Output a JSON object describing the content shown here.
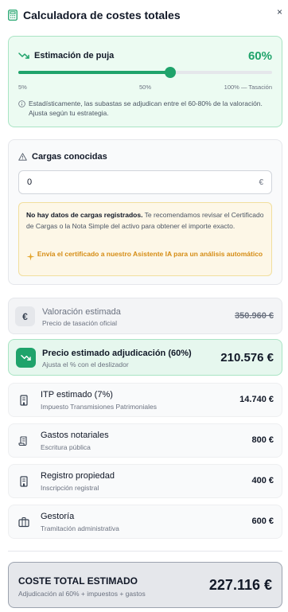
{
  "header": {
    "title": "Calculadora de costes totales",
    "close_icon": "×"
  },
  "bid_estimate": {
    "label": "Estimación de puja",
    "percent_label": "60%",
    "slider_value": 0.6,
    "slider_min_label": "5%",
    "slider_mid_label": "50%",
    "slider_max_label": "100% — Tasación",
    "note": "Estadísticamente, las subastas se adjudican entre el 60-80% de la valoración. Ajusta según tu estrategia.",
    "accent": "#1fa36b"
  },
  "loads": {
    "label": "Cargas conocidas",
    "input_value": "0",
    "currency": "€",
    "alert_bold": "No hay datos de cargas registrados.",
    "alert_text": " Te recomendamos revisar el Certificado de Cargas o la Nota Simple del activo para obtener el importe exacto.",
    "ai_link": "Envía el certificado a nuestro Asistente IA para un análisis automático"
  },
  "valuation": {
    "icon": "€",
    "title": "Valoración estimada",
    "subtitle": "Precio de tasación oficial",
    "amount": "350.960 €"
  },
  "adjudication": {
    "title": "Precio estimado adjudicación (60%)",
    "subtitle": "Ajusta el % con el deslizador",
    "amount": "210.576 €"
  },
  "items": [
    {
      "title": "ITP estimado (7%)",
      "subtitle": "Impuesto Transmisiones Patrimoniales",
      "amount": "14.740 €",
      "icon": "building-icon"
    },
    {
      "title": "Gastos notariales",
      "subtitle": "Escritura pública",
      "amount": "800 €",
      "icon": "scroll-icon"
    },
    {
      "title": "Registro propiedad",
      "subtitle": "Inscripción registral",
      "amount": "400 €",
      "icon": "building-icon"
    },
    {
      "title": "Gestoría",
      "subtitle": "Tramitación administrativa",
      "amount": "600 €",
      "icon": "briefcase-icon"
    }
  ],
  "total": {
    "title": "COSTE TOTAL ESTIMADO",
    "subtitle": "Adjudicación al 60% + impuestos + gastos",
    "amount": "227.116 €"
  }
}
